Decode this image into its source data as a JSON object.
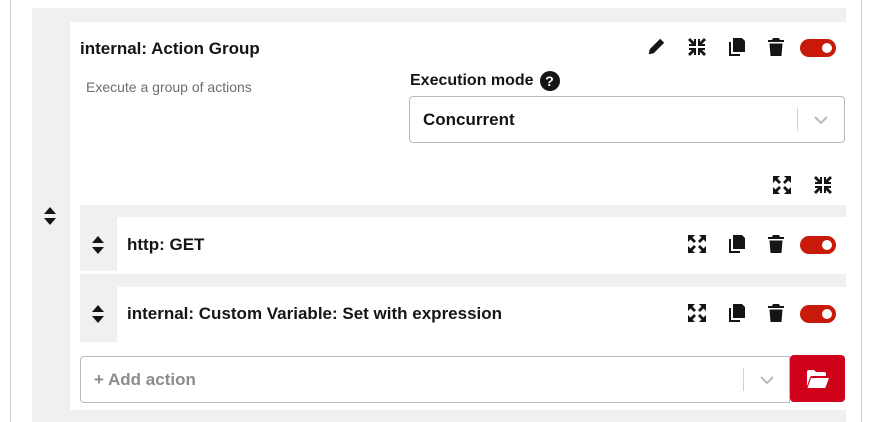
{
  "action_group": {
    "title": "internal: Action Group",
    "description": "Execute a group of actions",
    "execution_mode": {
      "label": "Execution mode",
      "help": "?",
      "value": "Concurrent"
    }
  },
  "child_actions": [
    {
      "title": "http: GET"
    },
    {
      "title": "internal: Custom Variable: Set with expression"
    }
  ],
  "add_action": {
    "placeholder": "+ Add action"
  },
  "colors": {
    "toggle_on": "#c9190b",
    "primary_button": "#d0021b",
    "panel_background": "#f0f0f0"
  }
}
